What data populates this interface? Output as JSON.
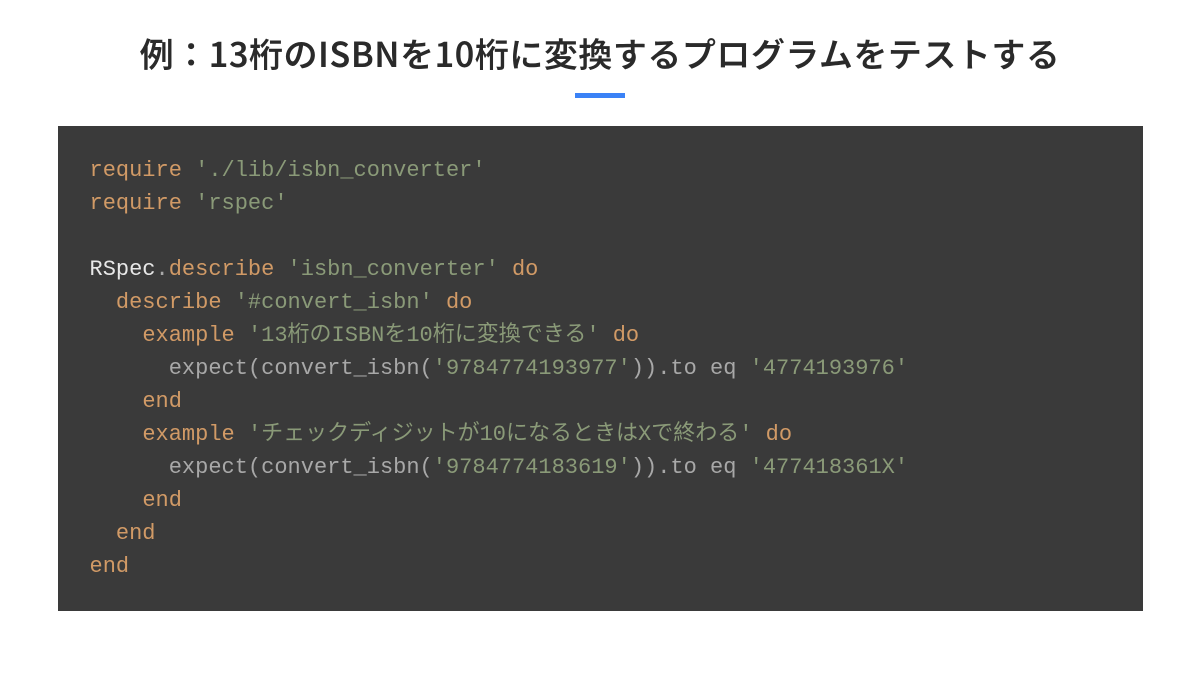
{
  "title": "例：13桁のISBNを10桁に変換するプログラムをテストする",
  "code": {
    "lines": [
      {
        "indent": 0,
        "tokens": [
          {
            "cls": "kw",
            "t": "require"
          },
          {
            "cls": "punct",
            "t": " "
          },
          {
            "cls": "str",
            "t": "'./lib/isbn_converter'"
          }
        ]
      },
      {
        "indent": 0,
        "tokens": [
          {
            "cls": "kw",
            "t": "require"
          },
          {
            "cls": "punct",
            "t": " "
          },
          {
            "cls": "str",
            "t": "'rspec'"
          }
        ]
      },
      {
        "blank": true
      },
      {
        "indent": 0,
        "tokens": [
          {
            "cls": "ident",
            "t": "RSpec"
          },
          {
            "cls": "punct",
            "t": "."
          },
          {
            "cls": "method",
            "t": "describe"
          },
          {
            "cls": "punct",
            "t": " "
          },
          {
            "cls": "str",
            "t": "'isbn_converter'"
          },
          {
            "cls": "punct",
            "t": " "
          },
          {
            "cls": "kw",
            "t": "do"
          }
        ]
      },
      {
        "indent": 1,
        "tokens": [
          {
            "cls": "method",
            "t": "describe"
          },
          {
            "cls": "punct",
            "t": " "
          },
          {
            "cls": "str",
            "t": "'#convert_isbn'"
          },
          {
            "cls": "punct",
            "t": " "
          },
          {
            "cls": "kw",
            "t": "do"
          }
        ]
      },
      {
        "indent": 2,
        "tokens": [
          {
            "cls": "method",
            "t": "example"
          },
          {
            "cls": "punct",
            "t": " "
          },
          {
            "cls": "str",
            "t": "'13桁のISBNを10桁に変換できる'"
          },
          {
            "cls": "punct",
            "t": " "
          },
          {
            "cls": "kw",
            "t": "do"
          }
        ]
      },
      {
        "indent": 3,
        "tokens": [
          {
            "cls": "punct",
            "t": "expect(convert_isbn("
          },
          {
            "cls": "str",
            "t": "'9784774193977'"
          },
          {
            "cls": "punct",
            "t": ")).to eq "
          },
          {
            "cls": "str",
            "t": "'4774193976'"
          }
        ]
      },
      {
        "indent": 2,
        "tokens": [
          {
            "cls": "kw",
            "t": "end"
          }
        ]
      },
      {
        "indent": 2,
        "tokens": [
          {
            "cls": "method",
            "t": "example"
          },
          {
            "cls": "punct",
            "t": " "
          },
          {
            "cls": "str",
            "t": "'チェックディジットが10になるときはXで終わる'"
          },
          {
            "cls": "punct",
            "t": " "
          },
          {
            "cls": "kw",
            "t": "do"
          }
        ]
      },
      {
        "indent": 3,
        "tokens": [
          {
            "cls": "punct",
            "t": "expect(convert_isbn("
          },
          {
            "cls": "str",
            "t": "'9784774183619'"
          },
          {
            "cls": "punct",
            "t": ")).to eq "
          },
          {
            "cls": "str",
            "t": "'477418361X'"
          }
        ]
      },
      {
        "indent": 2,
        "tokens": [
          {
            "cls": "kw",
            "t": "end"
          }
        ]
      },
      {
        "indent": 1,
        "tokens": [
          {
            "cls": "kw",
            "t": "end"
          }
        ]
      },
      {
        "indent": 0,
        "tokens": [
          {
            "cls": "kw",
            "t": "end"
          }
        ]
      }
    ]
  }
}
